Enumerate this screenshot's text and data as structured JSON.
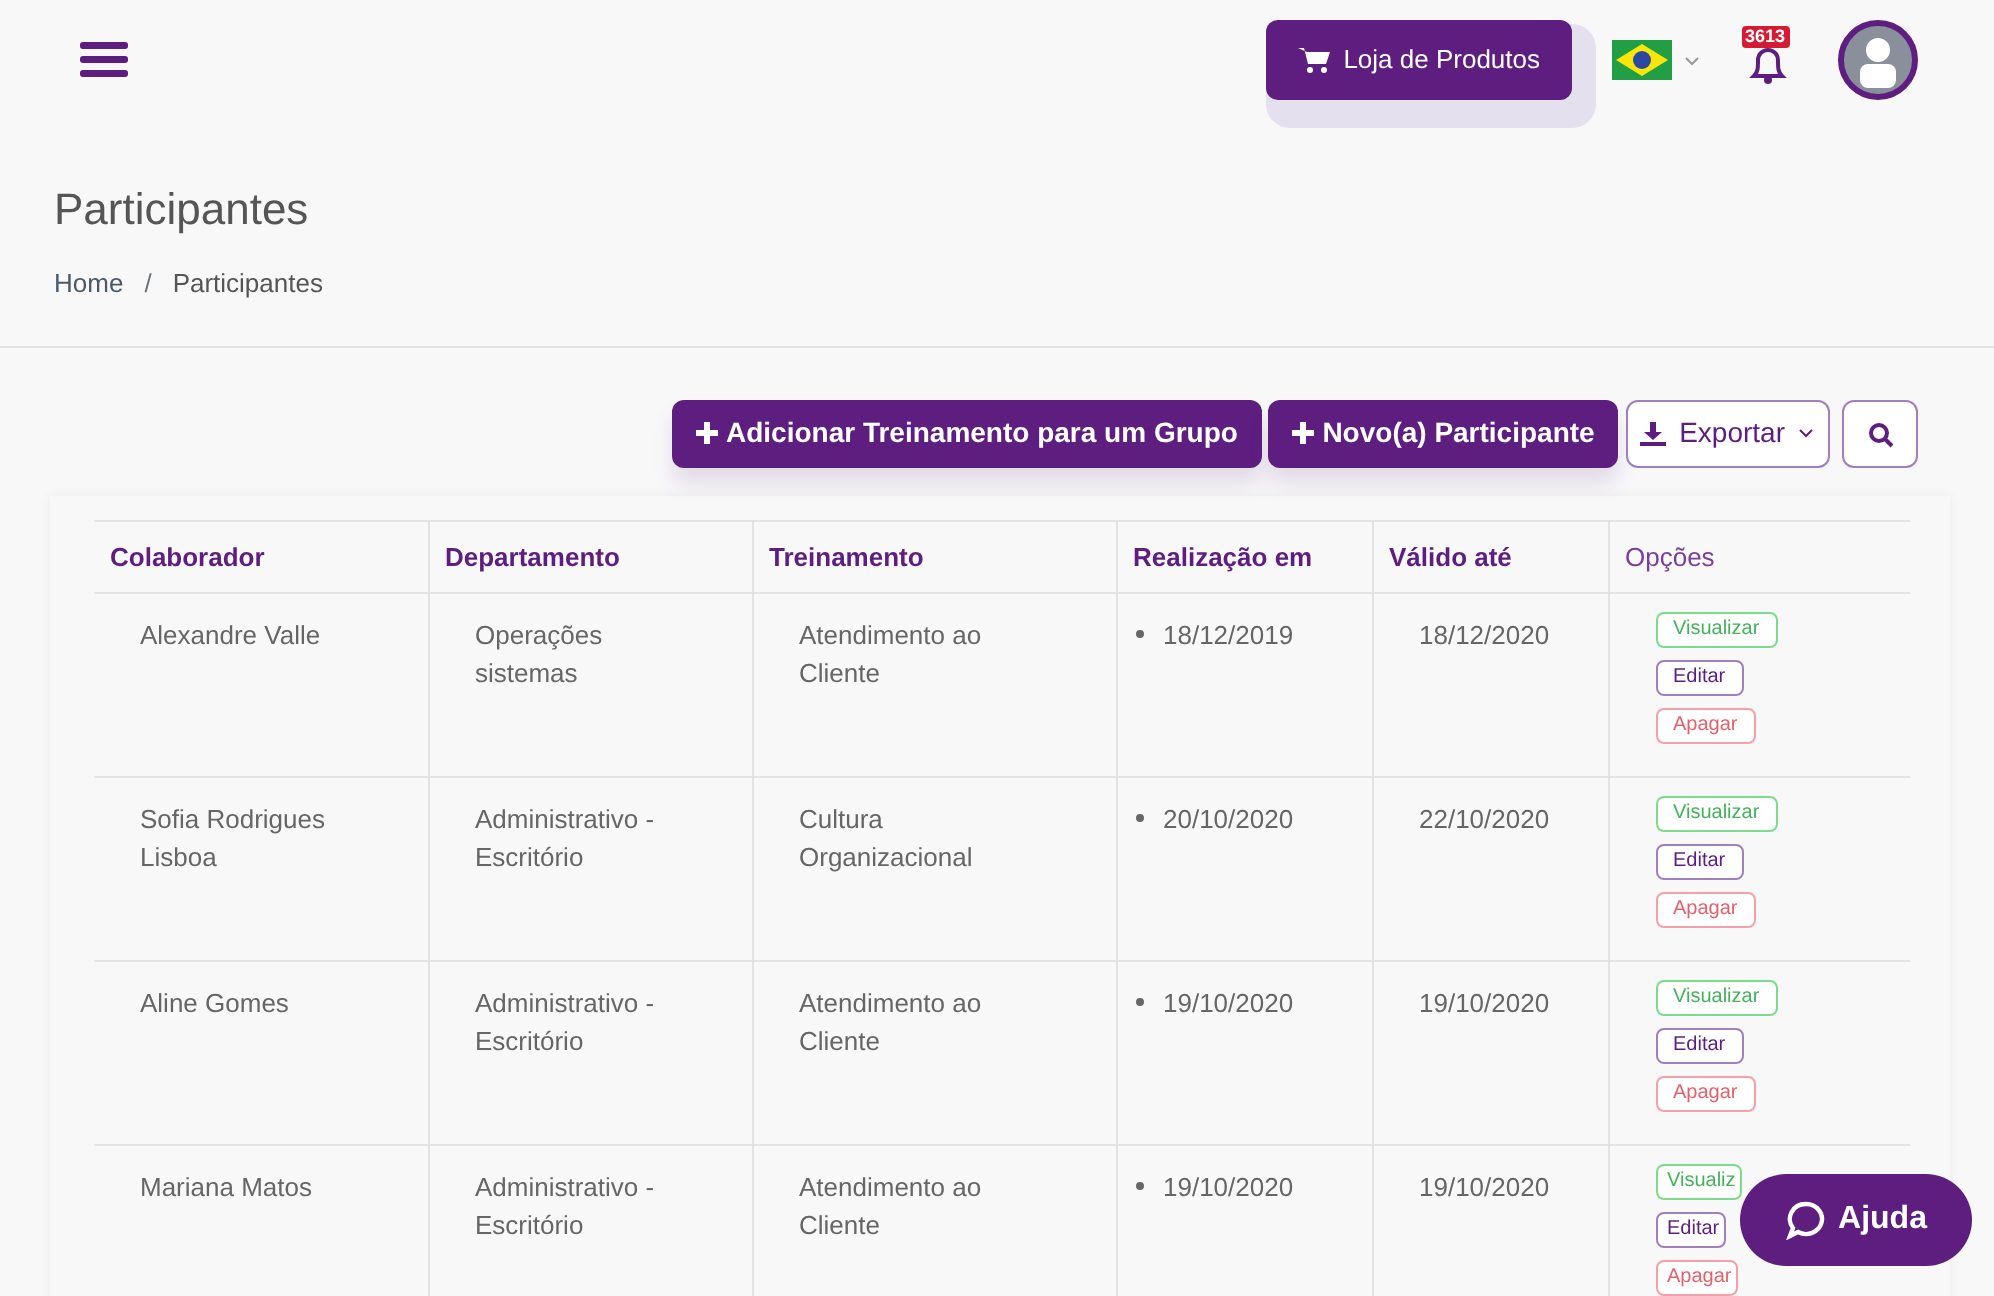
{
  "topbar": {
    "store_button": "Loja de Produtos",
    "notification_count": "3613"
  },
  "page": {
    "title": "Participantes",
    "breadcrumb_separator": "/",
    "breadcrumb": [
      {
        "label": "Home",
        "selected": false
      },
      {
        "label": "Participantes",
        "selected": true
      }
    ]
  },
  "actions": {
    "add_group_training": "Adicionar Treinamento para um Grupo",
    "new_participant": "Novo(a) Participante",
    "export": "Exportar"
  },
  "table": {
    "columns": [
      "Colaborador",
      "Departamento",
      "Treinamento",
      "Realização em",
      "Válido até",
      "Opções"
    ],
    "rows": [
      {
        "collaborator": "Alexandre Valle",
        "department": "Operações sistemas",
        "training": "Atendimento ao Cliente",
        "done_on": "18/12/2019",
        "valid_until": "18/12/2020",
        "options": [
          "Visualizar",
          "Editar",
          "Apagar"
        ]
      },
      {
        "collaborator": "Sofia Rodrigues Lisboa",
        "department": "Administrativo - Escritório",
        "training": "Cultura Organizacional",
        "done_on": "20/10/2020",
        "valid_until": "22/10/2020",
        "options": [
          "Visualizar",
          "Editar",
          "Apagar"
        ]
      },
      {
        "collaborator": "Aline Gomes",
        "department": "Administrativo - Escritório",
        "training": "Atendimento ao Cliente",
        "done_on": "19/10/2020",
        "valid_until": "19/10/2020",
        "options": [
          "Visualizar",
          "Editar",
          "Apagar"
        ]
      },
      {
        "collaborator": "Mariana Matos",
        "department": "Administrativo - Escritório",
        "training": "Atendimento ao Cliente",
        "done_on": "19/10/2020",
        "valid_until": "19/10/2020",
        "options": [
          "Visualiz",
          "Editar",
          "Apagar"
        ]
      }
    ]
  },
  "help_button": "Ajuda"
}
